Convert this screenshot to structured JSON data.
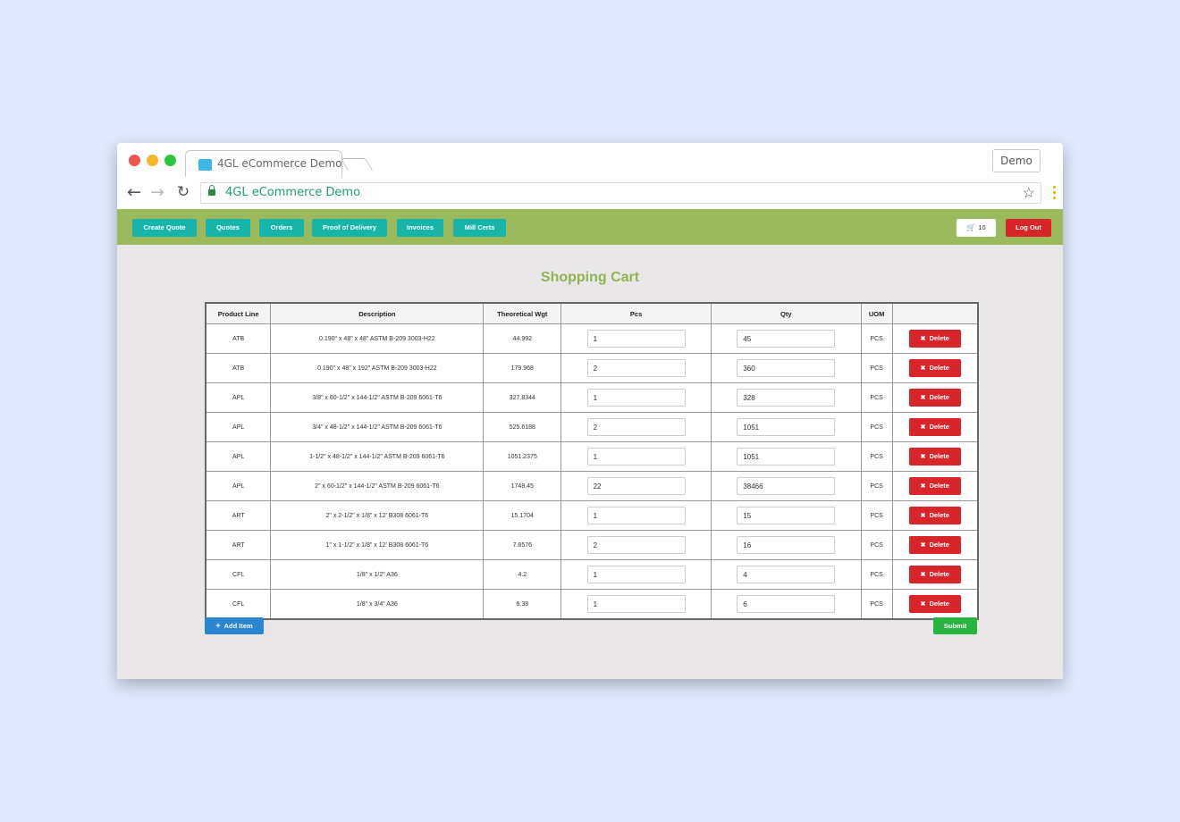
{
  "browser": {
    "tab_title": "4GL eCommerce Demo",
    "profile_label": "Demo",
    "url": "4GL eCommerce Demo",
    "icons": {
      "back": "←",
      "forward": "→",
      "reload": "↻",
      "star": "☆"
    }
  },
  "nav": {
    "items": [
      {
        "label": "Create Quote"
      },
      {
        "label": "Quotes"
      },
      {
        "label": "Orders"
      },
      {
        "label": "Proof of Delivery"
      },
      {
        "label": "Invoices"
      },
      {
        "label": "Mill Certs"
      }
    ],
    "cart_count": "10",
    "logout_label": "Log Out"
  },
  "page": {
    "title": "Shopping Cart"
  },
  "table": {
    "headers": [
      "Product Line",
      "Description",
      "Theoretical Wgt",
      "Pcs",
      "Qty",
      "UOM",
      ""
    ],
    "rows": [
      {
        "product_line": "ATB",
        "description": "0.190\" x 48\" x 48\" ASTM B-209 3003-H22",
        "wgt": "44.992",
        "pcs": "1",
        "qty": "45",
        "uom": "PCS"
      },
      {
        "product_line": "ATB",
        "description": "0.190\" x 48\" x 192\" ASTM B-209 3003-H22",
        "wgt": "179.968",
        "pcs": "2",
        "qty": "360",
        "uom": "PCS"
      },
      {
        "product_line": "APL",
        "description": "3/8\" x 60-1/2\" x 144-1/2\" ASTM B-209 6061-T6",
        "wgt": "327.8344",
        "pcs": "1",
        "qty": "328",
        "uom": "PCS"
      },
      {
        "product_line": "APL",
        "description": "3/4\" x 48-1/2\" x 144-1/2\" ASTM B-209 6061-T6",
        "wgt": "525.6188",
        "pcs": "2",
        "qty": "1051",
        "uom": "PCS"
      },
      {
        "product_line": "APL",
        "description": "1-1/2\" x 48-1/2\" x 144-1/2\" ASTM B-209 6061-T6",
        "wgt": "1051.2375",
        "pcs": "1",
        "qty": "1051",
        "uom": "PCS"
      },
      {
        "product_line": "APL",
        "description": "2\" x 60-1/2\" x 144-1/2\" ASTM B-209 6061-T6",
        "wgt": "1748.45",
        "pcs": "22",
        "qty": "38466",
        "uom": "PCS"
      },
      {
        "product_line": "ART",
        "description": "2\" x 2-1/2\" x 1/8\" x 12' B308 6061-T6",
        "wgt": "15.1704",
        "pcs": "1",
        "qty": "15",
        "uom": "PCS"
      },
      {
        "product_line": "ART",
        "description": "1\" x 1-1/2\" x 1/8\" x 12' B308 6061-T6",
        "wgt": "7.8576",
        "pcs": "2",
        "qty": "16",
        "uom": "PCS"
      },
      {
        "product_line": "CFL",
        "description": "1/8\" x 1/2\" A36",
        "wgt": "4.2",
        "pcs": "1",
        "qty": "4",
        "uom": "PCS"
      },
      {
        "product_line": "CFL",
        "description": "1/8\" x 3/4\" A36",
        "wgt": "6.38",
        "pcs": "1",
        "qty": "6",
        "uom": "PCS"
      }
    ],
    "delete_label": "Delete"
  },
  "actions": {
    "add_item_label": "Add Item",
    "submit_label": "Submit"
  },
  "colors": {
    "nav_bg": "#9aba5b",
    "nav_button": "#17b4a9",
    "danger": "#d9242a",
    "primary": "#2a86d1",
    "success": "#27b441",
    "title": "#8fb355"
  }
}
